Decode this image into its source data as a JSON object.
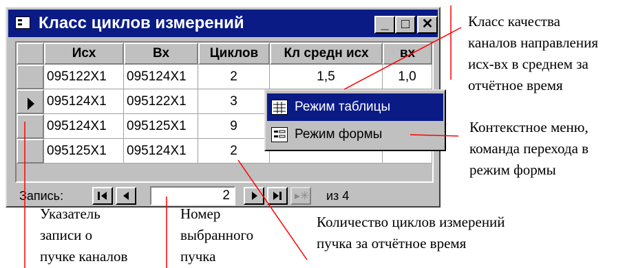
{
  "window": {
    "title": "Класс циклов измерений",
    "buttons": {
      "minimize": "_",
      "maximize": "□",
      "close": "✕"
    }
  },
  "table": {
    "columns": [
      "Исх",
      "Вх",
      "Циклов",
      "Кл средн исх",
      "вх"
    ],
    "rows": [
      [
        "095122X1",
        "095124X1",
        "2",
        "1,5",
        "1,0"
      ],
      [
        "095124X1",
        "095122X1",
        "3",
        "",
        ""
      ],
      [
        "095124X1",
        "095125X1",
        "9",
        "",
        ""
      ],
      [
        "095125X1",
        "095124X1",
        "2",
        "",
        ""
      ]
    ],
    "current_row_index": 1
  },
  "navigation": {
    "label": "Запись:",
    "record_number": "2",
    "of_text": "из 4"
  },
  "context_menu": {
    "items": [
      {
        "label": "Режим таблицы",
        "selected": true,
        "icon": "datasheet-icon"
      },
      {
        "label": "Режим формы",
        "selected": false,
        "icon": "form-icon"
      }
    ]
  },
  "annotations": {
    "quality_class": [
      "Класс качества",
      "каналов направления",
      "исх-вх в среднем за",
      "отчётное время"
    ],
    "context_menu_note": [
      "Контекстное  меню,",
      "команда перехода  в",
      "режим формы"
    ],
    "record_pointer": [
      "Указатель",
      "записи о",
      "пучке каналов"
    ],
    "selected_number": [
      "Номер",
      "выбранного",
      "пучка"
    ],
    "cycles_count": [
      "Количество циклов измерений",
      "пучка за отчётное время"
    ]
  },
  "colors": {
    "titlebar": "#0a1b86",
    "menu_highlight": "#0a1b86",
    "callout_line": "#ff0000",
    "face": "#c0c0c0"
  }
}
